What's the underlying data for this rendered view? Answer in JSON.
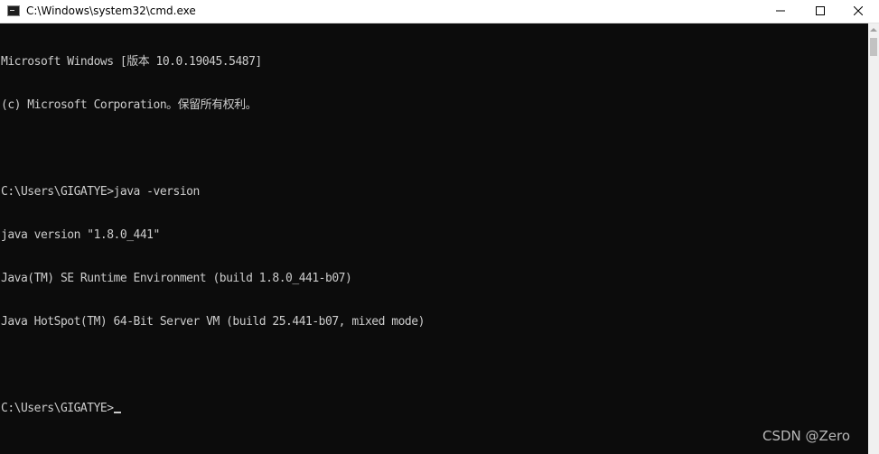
{
  "window": {
    "title": "C:\\Windows\\system32\\cmd.exe",
    "icon": "cmd-icon"
  },
  "controls": {
    "minimize_icon": "minimize-icon",
    "maximize_icon": "maximize-icon",
    "close_icon": "close-icon"
  },
  "console": {
    "lines": [
      "Microsoft Windows [版本 10.0.19045.5487]",
      "(c) Microsoft Corporation。保留所有权利。",
      "",
      "C:\\Users\\GIGATYE>java -version",
      "java version \"1.8.0_441\"",
      "Java(TM) SE Runtime Environment (build 1.8.0_441-b07)",
      "Java HotSpot(TM) 64-Bit Server VM (build 25.441-b07, mixed mode)",
      "",
      "C:\\Users\\GIGATYE>"
    ]
  },
  "watermark": "CSDN @Zero",
  "colors": {
    "console_bg": "#0c0c0c",
    "console_fg": "#cccccc",
    "titlebar_bg": "#ffffff"
  }
}
